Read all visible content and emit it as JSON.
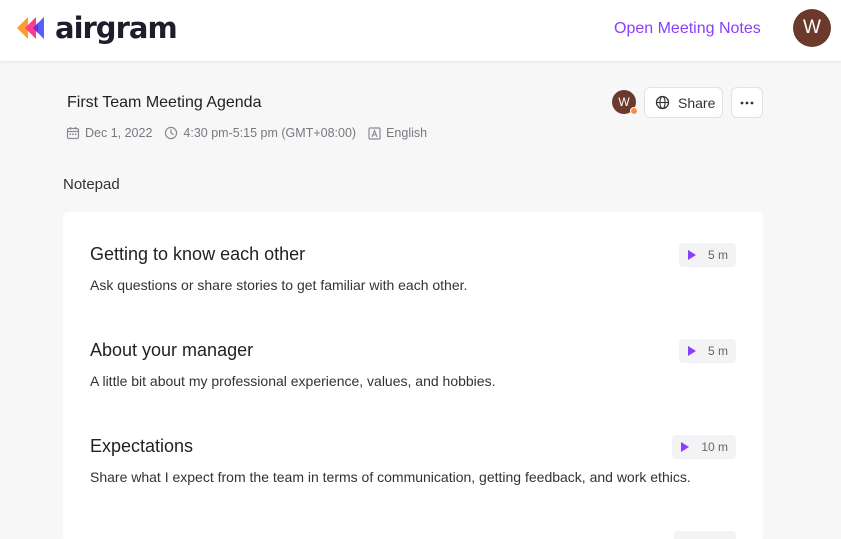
{
  "header": {
    "brand": "airgram",
    "open_notes_label": "Open Meeting Notes",
    "user_initial": "W"
  },
  "meeting": {
    "title": "First Team Meeting Agenda",
    "date": "Dec 1, 2022",
    "time": "4:30 pm-5:15 pm (GMT+08:00)",
    "language": "English",
    "participant_initial": "W",
    "share_label": "Share"
  },
  "notepad": {
    "label": "Notepad",
    "items": [
      {
        "title": "Getting to know each other",
        "description": "Ask questions or share stories to get familiar with each other.",
        "duration": "5 m"
      },
      {
        "title": "About your manager",
        "description": "A little bit about my professional experience, values, and hobbies.",
        "duration": "5 m"
      },
      {
        "title": "Expectations",
        "description": "Share what I expect from the team in terms of communication, getting feedback, and work ethics.",
        "duration": "10 m"
      }
    ]
  },
  "colors": {
    "accent": "#8a3ffc",
    "avatar": "#6b3a2c",
    "status_dot": "#ff8a3d"
  }
}
